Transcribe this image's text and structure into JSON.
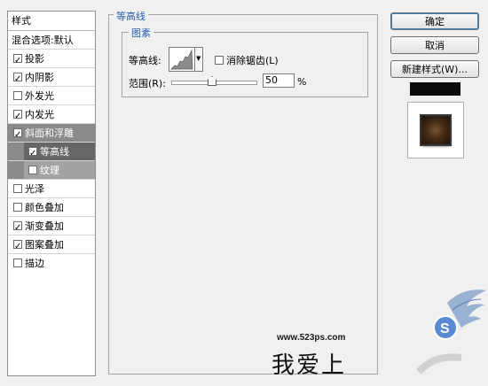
{
  "style_list": {
    "header": "样式",
    "items": [
      {
        "label": "混合选项:默认",
        "checkbox": false,
        "checked": false
      },
      {
        "label": "投影",
        "checkbox": true,
        "checked": true
      },
      {
        "label": "内阴影",
        "checkbox": true,
        "checked": true
      },
      {
        "label": "外发光",
        "checkbox": true,
        "checked": false
      },
      {
        "label": "内发光",
        "checkbox": true,
        "checked": true
      },
      {
        "label": "斜面和浮雕",
        "checkbox": true,
        "checked": true
      },
      {
        "label": "等高线",
        "checkbox": true,
        "checked": true
      },
      {
        "label": "纹理",
        "checkbox": true,
        "checked": false
      },
      {
        "label": "光泽",
        "checkbox": true,
        "checked": false
      },
      {
        "label": "颜色叠加",
        "checkbox": true,
        "checked": false
      },
      {
        "label": "渐变叠加",
        "checkbox": true,
        "checked": true
      },
      {
        "label": "图案叠加",
        "checkbox": true,
        "checked": true
      },
      {
        "label": "描边",
        "checkbox": true,
        "checked": false
      }
    ]
  },
  "panel": {
    "section_title": "等高线",
    "group_title": "图素",
    "contour_label": "等高线:",
    "anti_alias_label": "消除锯齿(L)",
    "anti_alias_checked": false,
    "range_label": "范围(R):",
    "range_value": "50",
    "range_unit": "%"
  },
  "buttons": {
    "ok": "确定",
    "cancel": "取消",
    "new_style": "新建样式(W)..."
  },
  "watermark": {
    "url": "www.523ps.com",
    "text": "我爱上"
  }
}
